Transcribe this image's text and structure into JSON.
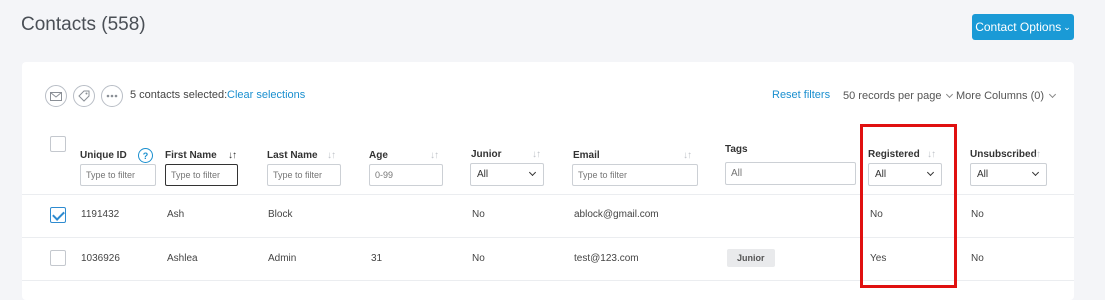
{
  "header": {
    "title": "Contacts (558)",
    "contact_options_label": "Contact Options"
  },
  "toolbar": {
    "selected_text": "5 contacts selected:",
    "clear_label": "Clear selections",
    "reset_label": "Reset filters",
    "per_page_label": "50 records per page",
    "more_columns_label": "More Columns (0)",
    "icons": [
      "email-icon",
      "tag-icon",
      "more-icon"
    ]
  },
  "columns": [
    {
      "label": "Unique ID",
      "filter_type": "input",
      "placeholder": "Type to filter"
    },
    {
      "label": "First Name",
      "filter_type": "input",
      "placeholder": "Type to filter"
    },
    {
      "label": "Last Name",
      "filter_type": "input",
      "placeholder": "Type to filter"
    },
    {
      "label": "Age",
      "filter_type": "input",
      "placeholder": "0-99"
    },
    {
      "label": "Junior",
      "filter_type": "select",
      "value": "All"
    },
    {
      "label": "Email",
      "filter_type": "input",
      "placeholder": "Type to filter"
    },
    {
      "label": "Tags",
      "filter_type": "input",
      "placeholder": "All"
    },
    {
      "label": "Registered",
      "filter_type": "select",
      "value": "All"
    },
    {
      "label": "Unsubscribed",
      "filter_type": "select",
      "value": "All"
    }
  ],
  "help_label": "?",
  "rows": [
    {
      "checked": true,
      "unique_id": "1191432",
      "first_name": "Ash",
      "last_name": "Block",
      "age": "",
      "junior": "No",
      "email": "ablock@gmail.com",
      "tags": "",
      "registered": "No",
      "unsubscribed": "No"
    },
    {
      "checked": false,
      "unique_id": "1036926",
      "first_name": "Ashlea",
      "last_name": "Admin",
      "age": "31",
      "junior": "No",
      "email": "test@123.com",
      "tags": "Junior",
      "registered": "Yes",
      "unsubscribed": "No"
    }
  ],
  "colors": {
    "accent": "#1a9ad6",
    "highlight": "#e01010"
  }
}
